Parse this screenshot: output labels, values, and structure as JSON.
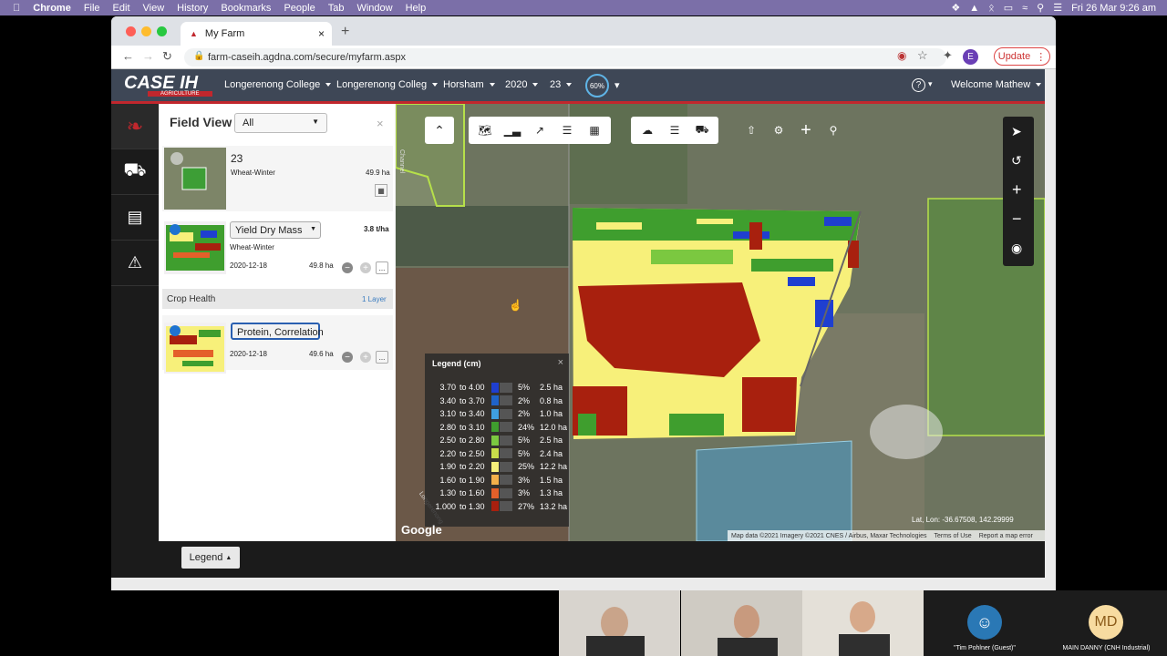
{
  "menubar": {
    "app": "Chrome",
    "items": [
      "File",
      "Edit",
      "View",
      "History",
      "Bookmarks",
      "People",
      "Tab",
      "Window",
      "Help"
    ],
    "clock": "Fri 26 Mar  9:26 am"
  },
  "browser": {
    "tab_title": "My Farm",
    "url": "farm-caseih.agdna.com/secure/myfarm.aspx",
    "profile_initial": "E",
    "update_label": "Update"
  },
  "header": {
    "brand": "CASE IH",
    "brand_sub": "AGRICULTURE",
    "dropdowns": [
      "Longerenong College",
      "Longerenong Colleg",
      "Horsham",
      "2020",
      "23"
    ],
    "progress_label": "60%",
    "help": "?",
    "welcome": "Welcome Mathew"
  },
  "panel": {
    "title": "Field View",
    "filter_value": "All",
    "field": {
      "name": "23",
      "crop": "Wheat-Winter",
      "area": "49.9 ha"
    },
    "yield_layer": {
      "select": "Yield Dry Mass",
      "rate": "3.8 t/ha",
      "crop": "Wheat-Winter",
      "date": "2020-12-18",
      "area": "49.8 ha",
      "more": "..."
    },
    "crop_health": {
      "title": "Crop Health",
      "layers": "1 Layer",
      "select": "Protein, Correlation",
      "date": "2020-12-18",
      "area": "49.6 ha",
      "more": "..."
    }
  },
  "map": {
    "legend_title": "Legend (cm)",
    "legend_rows": [
      {
        "from": "3.70",
        "to": "to 4.00",
        "pct": "5%",
        "ha": "2.5 ha",
        "color": "#1f3fd0"
      },
      {
        "from": "3.40",
        "to": "to 3.70",
        "pct": "2%",
        "ha": "0.8 ha",
        "color": "#1f63c8"
      },
      {
        "from": "3.10",
        "to": "to 3.40",
        "pct": "2%",
        "ha": "1.0 ha",
        "color": "#3fa0e0"
      },
      {
        "from": "2.80",
        "to": "to 3.10",
        "pct": "24%",
        "ha": "12.0 ha",
        "color": "#3f9e2e"
      },
      {
        "from": "2.50",
        "to": "to 2.80",
        "pct": "5%",
        "ha": "2.5 ha",
        "color": "#7bc840"
      },
      {
        "from": "2.20",
        "to": "to 2.50",
        "pct": "5%",
        "ha": "2.4 ha",
        "color": "#c8de4a"
      },
      {
        "from": "1.90",
        "to": "to 2.20",
        "pct": "25%",
        "ha": "12.2 ha",
        "color": "#f7f07a"
      },
      {
        "from": "1.60",
        "to": "to 1.90",
        "pct": "3%",
        "ha": "1.5 ha",
        "color": "#f4b04a"
      },
      {
        "from": "1.30",
        "to": "to 1.60",
        "pct": "3%",
        "ha": "1.3 ha",
        "color": "#e4602a"
      },
      {
        "from": "1.000",
        "to": "to 1.30",
        "pct": "27%",
        "ha": "13.2 ha",
        "color": "#a8200e"
      }
    ],
    "latlon": "Lat, Lon: -36.67508, 142.29999",
    "attribution": [
      "Map data ©2021 Imagery ©2021 CNES / Airbus, Maxar Technologies",
      "Terms of Use",
      "Report a map error"
    ],
    "google": "Google",
    "road_labels": [
      "Channel",
      "Longerenong"
    ]
  },
  "footer": {
    "legend_button": "Legend"
  },
  "video": {
    "guest_name": "\"Tim Pohlner (Guest)\"",
    "md_initials": "MD",
    "md_name": "MAIN DANNY (CNH Industrial)"
  }
}
